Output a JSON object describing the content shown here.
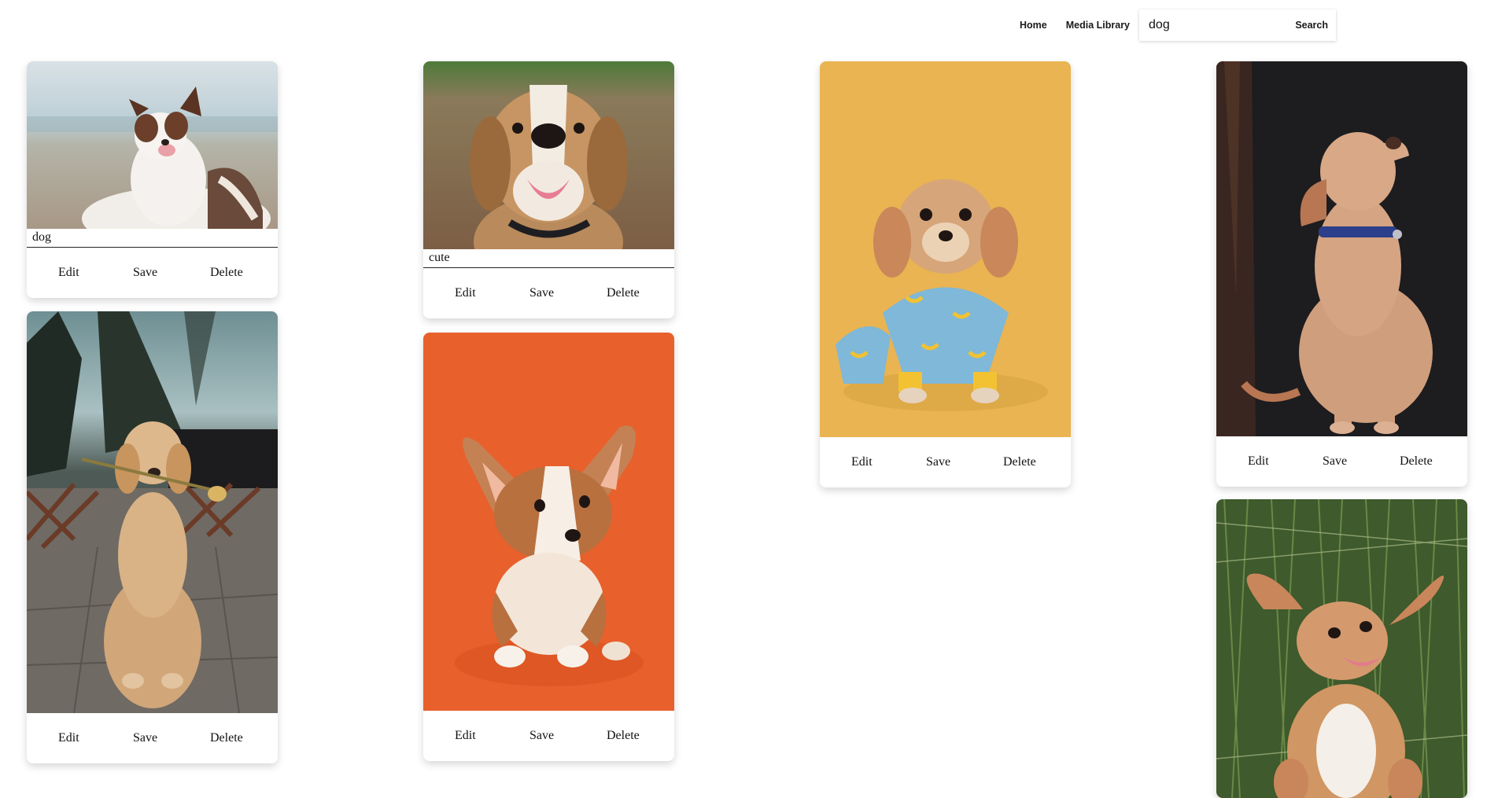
{
  "nav": {
    "home_label": "Home",
    "media_library_label": "Media Library",
    "search_value": "dog",
    "search_button_label": "Search"
  },
  "card_actions": {
    "edit": "Edit",
    "save": "Save",
    "delete": "Delete"
  },
  "cards": [
    {
      "caption": "dog",
      "subject": "border collie on beach"
    },
    {
      "caption": "",
      "subject": "golden retriever puppy with flower"
    },
    {
      "caption": "cute",
      "subject": "smiling beagle"
    },
    {
      "caption": "",
      "subject": "corgi puppy on orange background"
    },
    {
      "caption": "",
      "subject": "small dog in banana pajamas"
    },
    {
      "caption": "",
      "subject": "labrador puppy with blue collar"
    },
    {
      "caption": "",
      "subject": "cocker spaniel lying in grass"
    }
  ],
  "colors": {
    "accent_text": "#111111",
    "card_shadow": "rgba(0,0,0,0.16)",
    "orange_bg": "#e8602c",
    "mustard_bg": "#e9b451",
    "dark_bg": "#1d1c1f"
  }
}
